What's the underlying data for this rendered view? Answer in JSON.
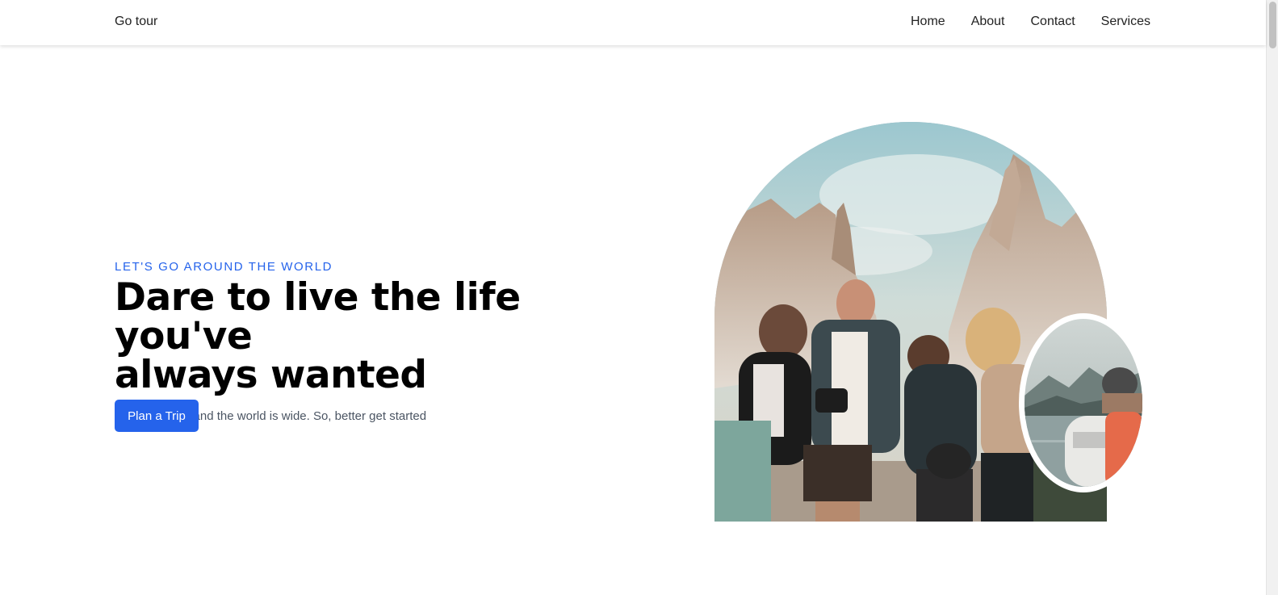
{
  "navbar": {
    "brand": "Go tour",
    "links": [
      "Home",
      "About",
      "Contact",
      "Services"
    ]
  },
  "hero": {
    "eyebrow": "LET'S GO AROUND THE WORLD",
    "title_line1": "Dare to live the life you've",
    "title_line2": "always wanted",
    "subtitle": "Life is shorted and the world is wide. So, better get started",
    "cta_label": "Plan a Trip"
  },
  "colors": {
    "accent": "#2563eb",
    "background": "#ffffff",
    "text": "#000000",
    "muted": "#4b5563"
  }
}
